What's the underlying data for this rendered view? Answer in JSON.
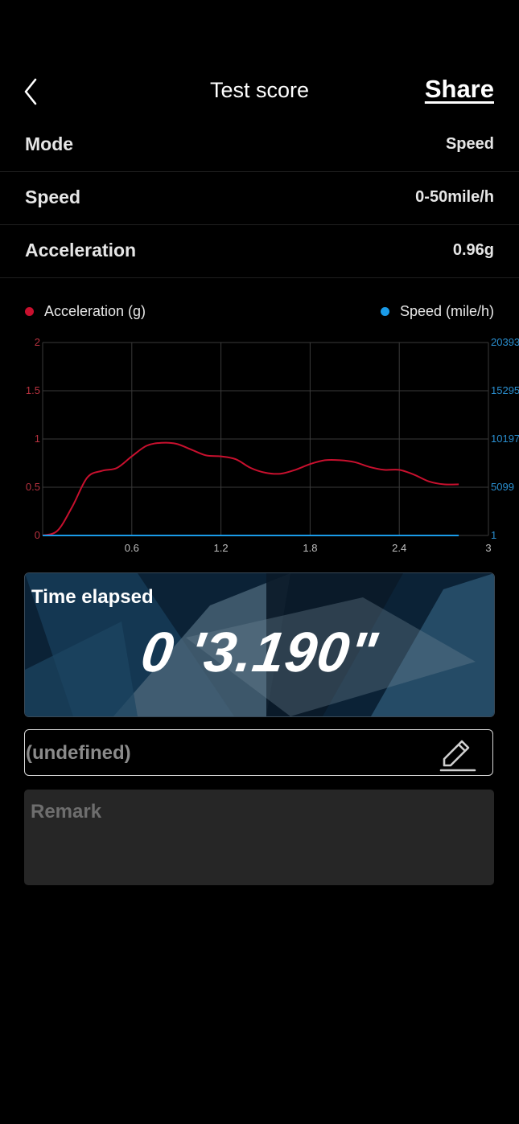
{
  "header": {
    "title": "Test score",
    "share_label": "Share",
    "back_icon": "chevron-left-icon"
  },
  "info": [
    {
      "label": "Mode",
      "value": "Speed"
    },
    {
      "label": "Speed",
      "value": "0-50mile/h"
    },
    {
      "label": "Acceleration",
      "value": "0.96g"
    }
  ],
  "legend": {
    "acceleration": {
      "label": "Acceleration (g)",
      "color": "#c8102e"
    },
    "speed": {
      "label": "Speed (mile/h)",
      "color": "#1a9be8"
    }
  },
  "chart_data": {
    "type": "line",
    "x": [
      0.0,
      0.1,
      0.2,
      0.3,
      0.4,
      0.5,
      0.6,
      0.7,
      0.8,
      0.9,
      1.0,
      1.1,
      1.2,
      1.3,
      1.4,
      1.5,
      1.6,
      1.7,
      1.8,
      1.9,
      2.0,
      2.1,
      2.2,
      2.3,
      2.4,
      2.5,
      2.6,
      2.7,
      2.8
    ],
    "series": [
      {
        "name": "Acceleration (g)",
        "axis": "left",
        "color": "#c8102e",
        "values": [
          0.0,
          0.05,
          0.3,
          0.6,
          0.67,
          0.7,
          0.82,
          0.93,
          0.96,
          0.95,
          0.89,
          0.83,
          0.82,
          0.79,
          0.7,
          0.65,
          0.64,
          0.68,
          0.74,
          0.78,
          0.78,
          0.76,
          0.71,
          0.68,
          0.68,
          0.63,
          0.56,
          0.53,
          0.53
        ]
      },
      {
        "name": "Speed (mile/h)",
        "axis": "right",
        "color": "#1a9be8",
        "values": [
          1,
          1,
          1,
          1,
          1,
          1,
          1,
          1,
          1,
          1,
          1,
          1,
          1,
          1,
          1,
          1,
          1,
          1,
          1,
          1,
          1,
          1,
          1,
          1,
          1,
          1,
          1,
          1,
          1
        ]
      }
    ],
    "x_ticks": [
      "0.6",
      "1.2",
      "1.8",
      "2.4",
      "3"
    ],
    "x_tick_values": [
      0.6,
      1.2,
      1.8,
      2.4,
      3.0
    ],
    "y_left_ticks": [
      "2",
      "1.5",
      "1",
      "0.5",
      "0"
    ],
    "y_left_tick_values": [
      2,
      1.5,
      1,
      0.5,
      0
    ],
    "y_right_ticks": [
      "20393",
      "15295",
      "10197",
      "5099",
      "1"
    ],
    "xlim": [
      0,
      3
    ],
    "ylim_left": [
      0,
      2
    ],
    "grid": true
  },
  "time": {
    "label": "Time elapsed",
    "value": "0 '3.190\""
  },
  "name_field": {
    "value": "(undefined)",
    "edit_icon": "pencil-edit-icon"
  },
  "remark": {
    "placeholder": "Remark"
  }
}
